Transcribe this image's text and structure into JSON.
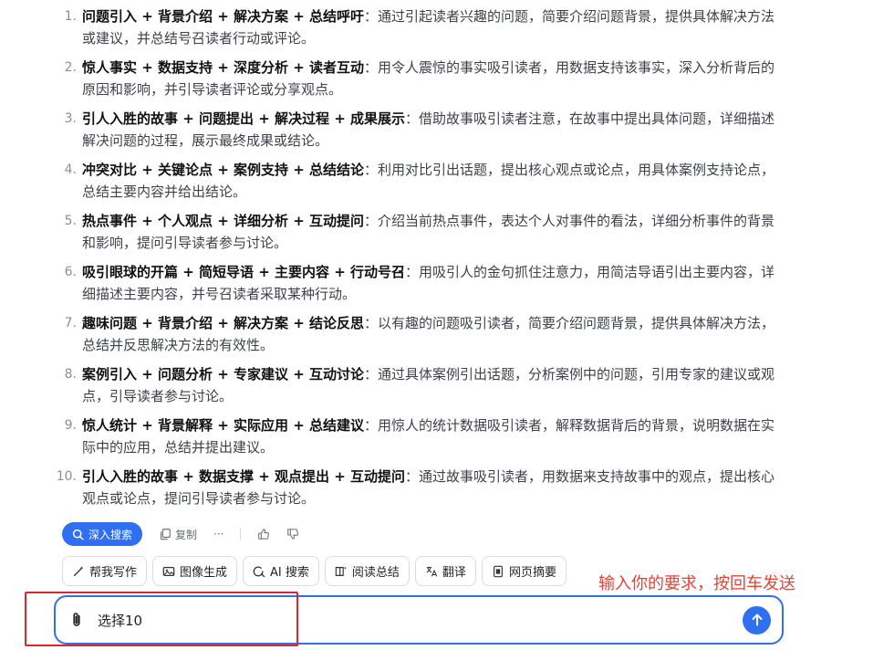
{
  "list": [
    {
      "num": "1.",
      "title": "问题引入 + 背景介绍 + 解决方案 + 总结呼吁",
      "desc": "：通过引起读者兴趣的问题，简要介绍问题背景，提供具体解决方法或建议，并总结号召读者行动或评论。"
    },
    {
      "num": "2.",
      "title": "惊人事实 + 数据支持 + 深度分析 + 读者互动",
      "desc": "：用令人震惊的事实吸引读者，用数据支持该事实，深入分析背后的原因和影响，并引导读者评论或分享观点。"
    },
    {
      "num": "3.",
      "title": "引人入胜的故事 + 问题提出 + 解决过程 + 成果展示",
      "desc": "：借助故事吸引读者注意，在故事中提出具体问题，详细描述解决问题的过程，展示最终成果或结论。"
    },
    {
      "num": "4.",
      "title": "冲突对比 + 关键论点 + 案例支持 + 总结结论",
      "desc": "：利用对比引出话题，提出核心观点或论点，用具体案例支持论点，总结主要内容并给出结论。"
    },
    {
      "num": "5.",
      "title": "热点事件 + 个人观点 + 详细分析 + 互动提问",
      "desc": "：介绍当前热点事件，表达个人对事件的看法，详细分析事件的背景和影响，提问引导读者参与讨论。"
    },
    {
      "num": "6.",
      "title": "吸引眼球的开篇 + 简短导语 + 主要内容 + 行动号召",
      "desc": "：用吸引人的金句抓住注意力，用简洁导语引出主要内容，详细描述主要内容，并号召读者采取某种行动。"
    },
    {
      "num": "7.",
      "title": "趣味问题 + 背景介绍 + 解决方案 + 结论反思",
      "desc": "：以有趣的问题吸引读者，简要介绍问题背景，提供具体解决方法，总结并反思解决方法的有效性。"
    },
    {
      "num": "8.",
      "title": "案例引入 + 问题分析 + 专家建议 + 互动讨论",
      "desc": "：通过具体案例引出话题，分析案例中的问题，引用专家的建议或观点，引导读者参与讨论。"
    },
    {
      "num": "9.",
      "title": "惊人统计 + 背景解释 + 实际应用 + 总结建议",
      "desc": "：用惊人的统计数据吸引读者，解释数据背后的背景，说明数据在实际中的应用，总结并提出建议。"
    },
    {
      "num": "10.",
      "title": "引人入胜的故事 + 数据支撑 + 观点提出 + 互动提问",
      "desc": "：通过故事吸引读者，用数据来支持故事中的观点，提出核心观点或论点，提问引导读者参与讨论。"
    }
  ],
  "actions": {
    "deep_search": "深入搜索",
    "copy": "复制",
    "more": "···"
  },
  "tools": [
    {
      "label": "帮我写作",
      "icon": "magic-pen-icon"
    },
    {
      "label": "图像生成",
      "icon": "image-icon"
    },
    {
      "label": "AI 搜索",
      "icon": "ai-search-icon"
    },
    {
      "label": "阅读总结",
      "icon": "read-summary-icon"
    },
    {
      "label": "翻译",
      "icon": "translate-icon"
    },
    {
      "label": "网页摘要",
      "icon": "web-summary-icon"
    }
  ],
  "hint": "输入你的要求，按回车发送",
  "input": {
    "value": "选择10"
  },
  "colors": {
    "accent": "#2f6ff2",
    "annotation": "#e84235"
  }
}
